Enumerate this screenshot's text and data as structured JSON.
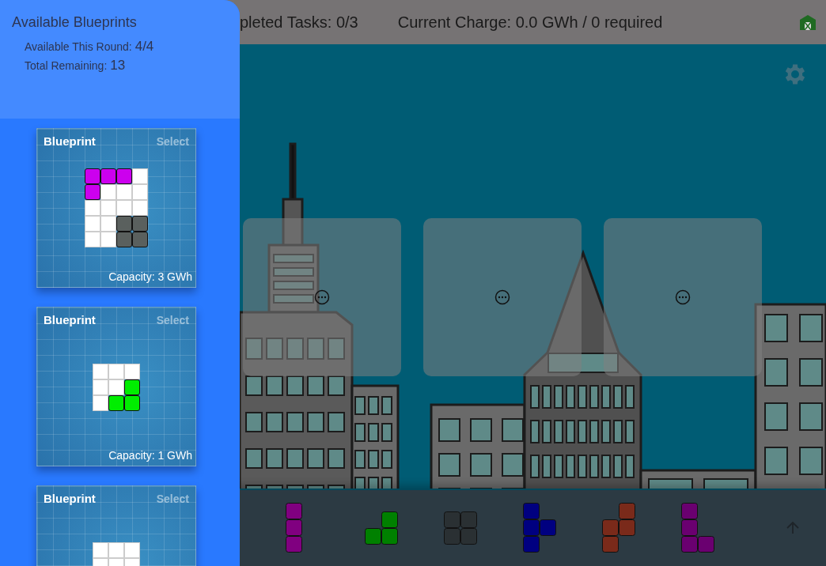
{
  "top_bar": {
    "tasks": "pleted Tasks: 0/3",
    "charge": "Current Charge: 0.0 GWh / 0 required"
  },
  "sidebar": {
    "title": "Available Blueprints",
    "stats": [
      {
        "label": "Available This Round:",
        "value": "4/4"
      },
      {
        "label": "Total Remaining:",
        "value": "13"
      }
    ]
  },
  "blueprints": [
    {
      "title": "Blueprint",
      "action": "Select",
      "capacity": "Capacity: 3 GWh",
      "grid": [
        [
          {
            "kind": "filled",
            "color": "#cc00ee"
          },
          {
            "kind": "filled",
            "color": "#cc00ee"
          },
          {
            "kind": "filled",
            "color": "#cc00ee"
          },
          {
            "kind": "empty"
          }
        ],
        [
          {
            "kind": "filled",
            "color": "#cc00ee"
          },
          {
            "kind": "empty"
          },
          {
            "kind": "empty"
          },
          {
            "kind": "empty"
          }
        ],
        [
          {
            "kind": "empty"
          },
          {
            "kind": "empty"
          },
          {
            "kind": "empty"
          },
          {
            "kind": "empty"
          }
        ],
        [
          {
            "kind": "empty"
          },
          {
            "kind": "empty"
          },
          {
            "kind": "filled",
            "color": "#5a605e"
          },
          {
            "kind": "filled",
            "color": "#5a605e"
          }
        ],
        [
          {
            "kind": "empty"
          },
          {
            "kind": "empty"
          },
          {
            "kind": "filled",
            "color": "#5a605e"
          },
          {
            "kind": "filled",
            "color": "#5a605e"
          }
        ]
      ]
    },
    {
      "title": "Blueprint",
      "action": "Select",
      "capacity": "Capacity: 1 GWh",
      "grid": [
        [
          {
            "kind": "empty"
          },
          {
            "kind": "empty"
          },
          {
            "kind": "empty"
          }
        ],
        [
          {
            "kind": "empty"
          },
          {
            "kind": "empty"
          },
          {
            "kind": "filled",
            "color": "#00ee00"
          }
        ],
        [
          {
            "kind": "empty"
          },
          {
            "kind": "filled",
            "color": "#00ee00"
          },
          {
            "kind": "filled",
            "color": "#00ee00"
          }
        ]
      ]
    },
    {
      "title": "Blueprint",
      "action": "Select",
      "grid": [
        [
          {
            "kind": "empty"
          },
          {
            "kind": "empty"
          },
          {
            "kind": "empty"
          }
        ],
        [
          {
            "kind": "empty"
          },
          {
            "kind": "empty"
          },
          {
            "kind": "empty"
          }
        ]
      ]
    }
  ],
  "slots": [
    {
      "kind": "empty"
    },
    {
      "kind": "empty"
    },
    {
      "kind": "empty"
    }
  ],
  "tray": [
    {
      "kind": "line",
      "color": "#800080"
    },
    {
      "kind": "corner",
      "color": "#008000"
    },
    {
      "kind": "square",
      "color": "#2a3033"
    },
    {
      "kind": "tee",
      "color": "#000080"
    },
    {
      "kind": "zigzag",
      "color": "#7a2a1a"
    },
    {
      "kind": "ell",
      "color": "#6a0070"
    }
  ]
}
